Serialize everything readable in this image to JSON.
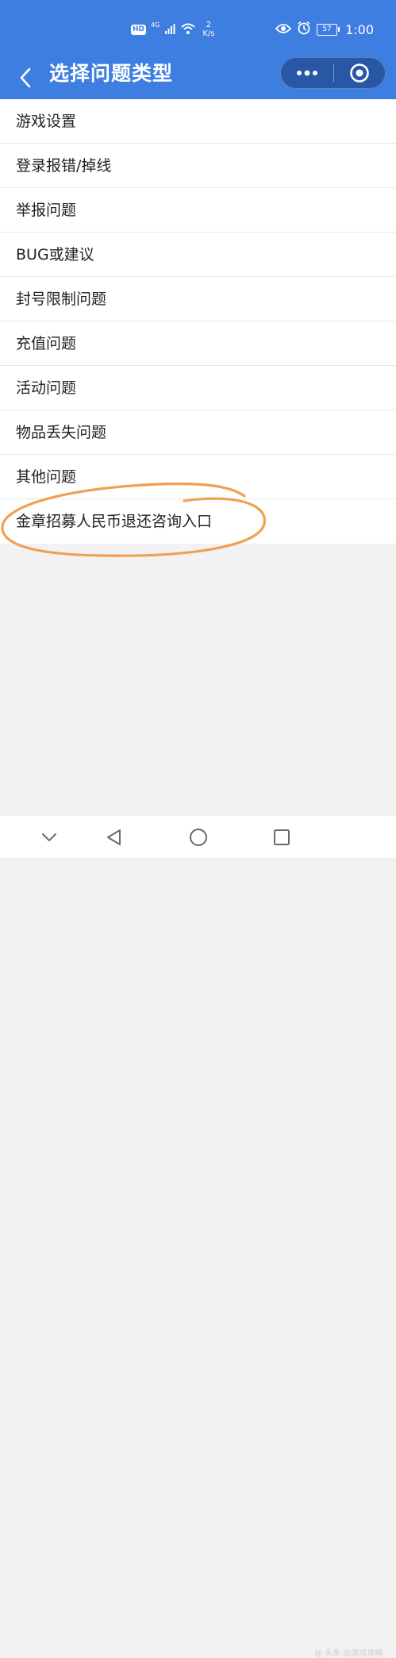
{
  "status_bar": {
    "hd_badge": "HD",
    "network_generation": "4G",
    "speed_value": "2",
    "speed_unit": "K/s",
    "battery_level": "57",
    "time": "1:00",
    "icons": [
      "signal-icon",
      "wifi-icon",
      "eye-icon",
      "alarm-icon",
      "battery-icon"
    ]
  },
  "nav": {
    "title": "选择问题类型",
    "icons": [
      "back-arrow-icon",
      "more-dots-icon",
      "close-target-icon"
    ]
  },
  "question_types": [
    {
      "label": "游戏设置"
    },
    {
      "label": "登录报错/掉线"
    },
    {
      "label": "举报问题"
    },
    {
      "label": "BUG或建议"
    },
    {
      "label": "封号限制问题"
    },
    {
      "label": "充值问题"
    },
    {
      "label": "活动问题"
    },
    {
      "label": "物品丢失问题"
    },
    {
      "label": "其他问题"
    },
    {
      "label": "金章招募人民币退还咨询入口"
    }
  ],
  "annotation": {
    "color": "#f0a050"
  },
  "system_nav": {
    "icons": [
      "collapse-chevron-icon",
      "back-triangle-icon",
      "home-circle-icon",
      "recents-square-icon"
    ]
  },
  "watermark": "@ 头条 @游戏攻略",
  "colors": {
    "header_blue": "#3d7ee0",
    "page_background": "#f2f2f2",
    "list_background": "#ffffff"
  }
}
